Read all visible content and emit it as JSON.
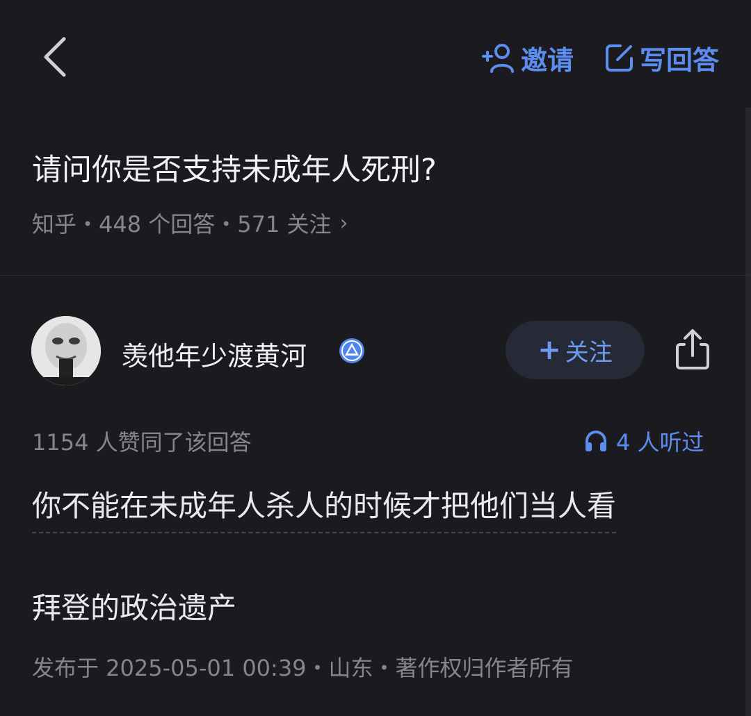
{
  "topbar": {
    "invite_label": "邀请",
    "write_label": "写回答"
  },
  "question": {
    "title": "请问你是否支持未成年人死刑?",
    "meta": "知乎・448 个回答・571 关注",
    "chevron": "›"
  },
  "author": {
    "name": "羡他年少渡黄河",
    "follow_label": "关注",
    "follow_plus": "+",
    "avatar_icon": "meme-face-avatar",
    "badge_icon": "verified-badge-icon"
  },
  "answer": {
    "votes": "1154 人赞同了该回答",
    "listen": "4 人听过",
    "paragraphs": [
      "你不能在未成年人杀人的时候才把他们当人看",
      "拜登的政治遗产"
    ],
    "publish_info": "发布于 2025-05-01 00:39・山东・著作权归作者所有"
  },
  "colors": {
    "background": "#1b1b1f",
    "accent": "#5b8ef0",
    "muted_text": "#85858d",
    "primary_text": "#eaeaee",
    "follow_button_bg": "#262a37"
  }
}
